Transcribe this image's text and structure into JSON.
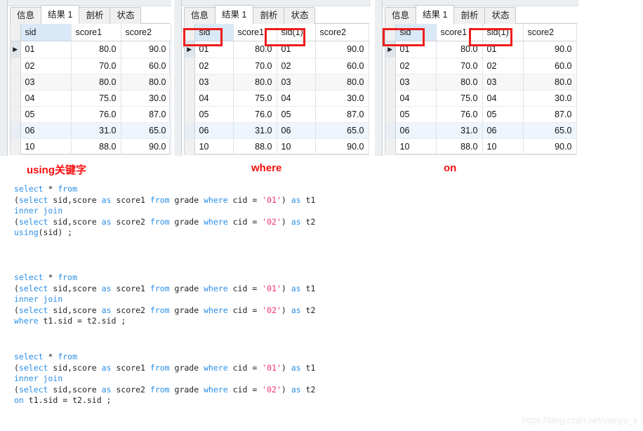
{
  "tabs": [
    "信息",
    "结果 1",
    "剖析",
    "状态"
  ],
  "active_tab_index": 1,
  "panels": [
    {
      "id": "using",
      "label": "using关键字",
      "columns": [
        "sid",
        "score1",
        "score2"
      ],
      "selected_column": "sid",
      "highlighted_columns": [
        "sid"
      ],
      "rows": [
        [
          "01",
          "80.0",
          "90.0"
        ],
        [
          "02",
          "70.0",
          "60.0"
        ],
        [
          "03",
          "80.0",
          "80.0"
        ],
        [
          "04",
          "75.0",
          "30.0"
        ],
        [
          "05",
          "76.0",
          "87.0"
        ],
        [
          "06",
          "31.0",
          "65.0"
        ],
        [
          "10",
          "88.0",
          "90.0"
        ]
      ]
    },
    {
      "id": "where",
      "label": "where",
      "columns": [
        "sid",
        "score1",
        "sid(1)",
        "score2"
      ],
      "selected_column": "sid",
      "highlighted_columns": [
        "sid",
        "sid(1)"
      ],
      "rows": [
        [
          "01",
          "80.0",
          "01",
          "90.0"
        ],
        [
          "02",
          "70.0",
          "02",
          "60.0"
        ],
        [
          "03",
          "80.0",
          "03",
          "80.0"
        ],
        [
          "04",
          "75.0",
          "04",
          "30.0"
        ],
        [
          "05",
          "76.0",
          "05",
          "87.0"
        ],
        [
          "06",
          "31.0",
          "06",
          "65.0"
        ],
        [
          "10",
          "88.0",
          "10",
          "90.0"
        ]
      ]
    },
    {
      "id": "on",
      "label": "on",
      "columns": [
        "sid",
        "score1",
        "sid(1)",
        "score2"
      ],
      "selected_column": "sid",
      "highlighted_columns": [
        "sid",
        "sid(1)"
      ],
      "rows": [
        [
          "01",
          "80.0",
          "01",
          "90.0"
        ],
        [
          "02",
          "70.0",
          "02",
          "60.0"
        ],
        [
          "03",
          "80.0",
          "03",
          "80.0"
        ],
        [
          "04",
          "75.0",
          "04",
          "30.0"
        ],
        [
          "05",
          "76.0",
          "05",
          "87.0"
        ],
        [
          "06",
          "31.0",
          "06",
          "65.0"
        ],
        [
          "10",
          "88.0",
          "10",
          "90.0"
        ]
      ]
    }
  ],
  "row_marker_glyph": "▶",
  "sql_blocks": [
    {
      "id": "sql-using",
      "lines": [
        [
          [
            "kw",
            "select"
          ],
          [
            "pl",
            " * "
          ],
          [
            "kw",
            "from"
          ]
        ],
        [
          [
            "pl",
            "("
          ],
          [
            "kw",
            "select"
          ],
          [
            "pl",
            " sid,score "
          ],
          [
            "kw",
            "as"
          ],
          [
            "pl",
            " score1 "
          ],
          [
            "kw",
            "from"
          ],
          [
            "pl",
            " grade "
          ],
          [
            "kw",
            "where"
          ],
          [
            "pl",
            " cid = "
          ],
          [
            "str",
            "'01'"
          ],
          [
            "pl",
            ") "
          ],
          [
            "kw",
            "as"
          ],
          [
            "pl",
            " t1"
          ]
        ],
        [
          [
            "kw",
            "inner join"
          ]
        ],
        [
          [
            "pl",
            "("
          ],
          [
            "kw",
            "select"
          ],
          [
            "pl",
            " sid,score "
          ],
          [
            "kw",
            "as"
          ],
          [
            "pl",
            " score2 "
          ],
          [
            "kw",
            "from"
          ],
          [
            "pl",
            " grade "
          ],
          [
            "kw",
            "where"
          ],
          [
            "pl",
            " cid = "
          ],
          [
            "str",
            "'02'"
          ],
          [
            "pl",
            ") "
          ],
          [
            "kw",
            "as"
          ],
          [
            "pl",
            " t2"
          ]
        ],
        [
          [
            "kw",
            "using"
          ],
          [
            "pl",
            "(sid) ;"
          ]
        ]
      ]
    },
    {
      "id": "sql-where",
      "lines": [
        [
          [
            "kw",
            "select"
          ],
          [
            "pl",
            " * "
          ],
          [
            "kw",
            "from"
          ]
        ],
        [
          [
            "pl",
            "("
          ],
          [
            "kw",
            "select"
          ],
          [
            "pl",
            " sid,score "
          ],
          [
            "kw",
            "as"
          ],
          [
            "pl",
            " score1 "
          ],
          [
            "kw",
            "from"
          ],
          [
            "pl",
            " grade "
          ],
          [
            "kw",
            "where"
          ],
          [
            "pl",
            " cid = "
          ],
          [
            "str",
            "'01'"
          ],
          [
            "pl",
            ") "
          ],
          [
            "kw",
            "as"
          ],
          [
            "pl",
            " t1"
          ]
        ],
        [
          [
            "kw",
            "inner join"
          ]
        ],
        [
          [
            "pl",
            "("
          ],
          [
            "kw",
            "select"
          ],
          [
            "pl",
            " sid,score "
          ],
          [
            "kw",
            "as"
          ],
          [
            "pl",
            " score2 "
          ],
          [
            "kw",
            "from"
          ],
          [
            "pl",
            " grade "
          ],
          [
            "kw",
            "where"
          ],
          [
            "pl",
            " cid = "
          ],
          [
            "str",
            "'02'"
          ],
          [
            "pl",
            ") "
          ],
          [
            "kw",
            "as"
          ],
          [
            "pl",
            " t2"
          ]
        ],
        [
          [
            "kw",
            "where"
          ],
          [
            "pl",
            " t1.sid = t2.sid ;"
          ]
        ]
      ]
    },
    {
      "id": "sql-on",
      "lines": [
        [
          [
            "kw",
            "select"
          ],
          [
            "pl",
            " * "
          ],
          [
            "kw",
            "from"
          ]
        ],
        [
          [
            "pl",
            "("
          ],
          [
            "kw",
            "select"
          ],
          [
            "pl",
            " sid,score "
          ],
          [
            "kw",
            "as"
          ],
          [
            "pl",
            " score1 "
          ],
          [
            "kw",
            "from"
          ],
          [
            "pl",
            " grade "
          ],
          [
            "kw",
            "where"
          ],
          [
            "pl",
            " cid = "
          ],
          [
            "str",
            "'01'"
          ],
          [
            "pl",
            ") "
          ],
          [
            "kw",
            "as"
          ],
          [
            "pl",
            " t1"
          ]
        ],
        [
          [
            "kw",
            "inner join"
          ]
        ],
        [
          [
            "pl",
            "("
          ],
          [
            "kw",
            "select"
          ],
          [
            "pl",
            " sid,score "
          ],
          [
            "kw",
            "as"
          ],
          [
            "pl",
            " score2 "
          ],
          [
            "kw",
            "from"
          ],
          [
            "pl",
            " grade "
          ],
          [
            "kw",
            "where"
          ],
          [
            "pl",
            " cid = "
          ],
          [
            "str",
            "'02'"
          ],
          [
            "pl",
            ") "
          ],
          [
            "kw",
            "as"
          ],
          [
            "pl",
            " t2"
          ]
        ],
        [
          [
            "kw",
            "on"
          ],
          [
            "pl",
            " t1.sid = t2.sid ;"
          ]
        ]
      ]
    }
  ],
  "watermark": "https://blog.csdn.net/xianyu_x",
  "colors": {
    "highlight_box": "#ee1c1c",
    "label_red": "#fb0c0c",
    "keyword_blue": "#2a8fe8",
    "string_pink": "#f0326e",
    "selected_header": "#d9e9f7"
  }
}
